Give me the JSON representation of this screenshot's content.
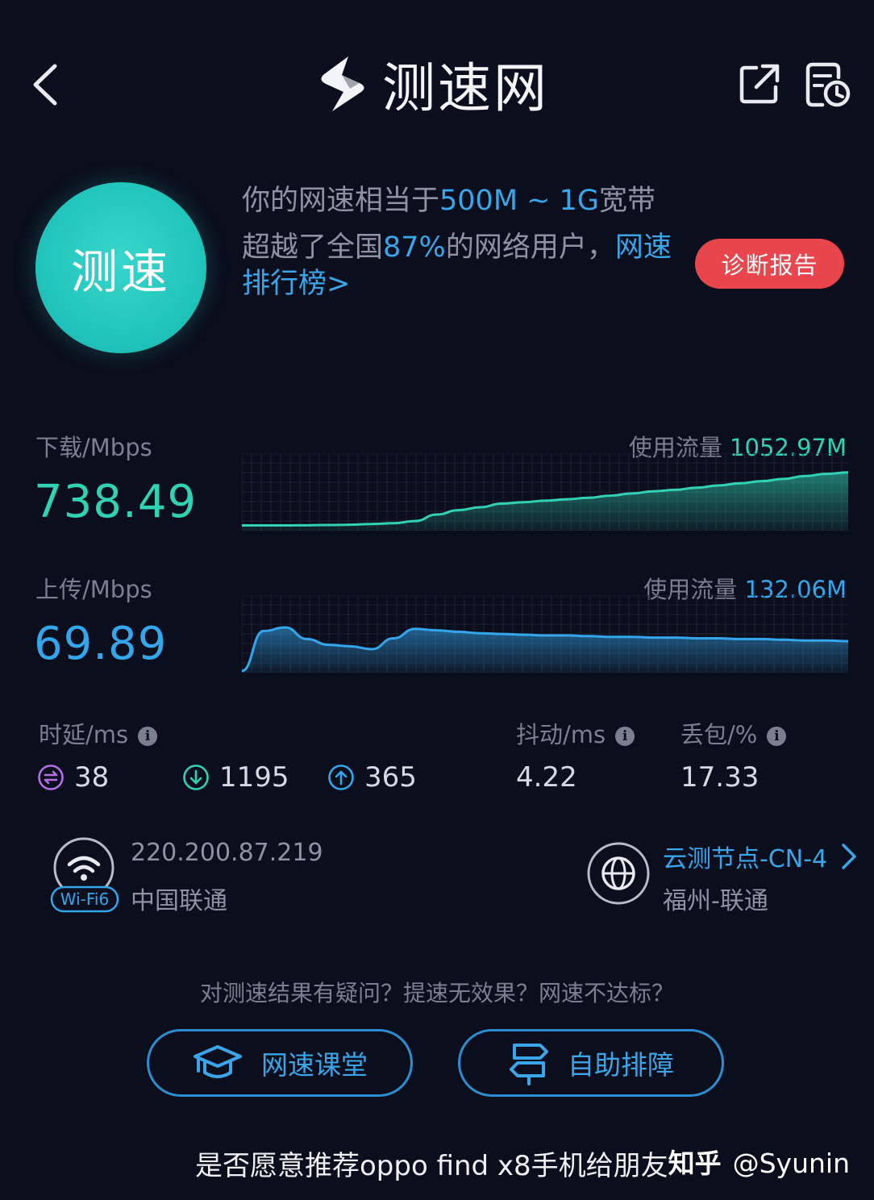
{
  "header": {
    "title": "测速网"
  },
  "test_button": {
    "label": "测速"
  },
  "summary": {
    "line1_prefix": "你的网速相当于",
    "line1_highlight": "500M ~ 1G",
    "line1_suffix": "宽带",
    "line2_prefix": "超越了全国",
    "line2_highlight": "87%",
    "line2_suffix": "的网络用户，",
    "rank_link": "网速排行榜>"
  },
  "diagnose_button": {
    "label": "诊断报告"
  },
  "download": {
    "label": "下载/Mbps",
    "value": "738.49",
    "traffic_label": "使用流量",
    "traffic_value": "1052.97M"
  },
  "upload": {
    "label": "上传/Mbps",
    "value": "69.89",
    "traffic_label": "使用流量",
    "traffic_value": "132.06M"
  },
  "latency": {
    "label": "时延/ms",
    "avg": "38",
    "down": "1195",
    "up": "365"
  },
  "jitter": {
    "label": "抖动/ms",
    "value": "4.22"
  },
  "packet_loss": {
    "label": "丢包/%",
    "value": "17.33"
  },
  "network": {
    "wifi_badge": "Wi-Fi6",
    "ip": "220.200.87.219",
    "isp": "中国联通"
  },
  "server": {
    "node": "云测节点-CN-4",
    "location": "福州-联通"
  },
  "footer": {
    "question": "对测速结果有疑问？提速无效果？网速不达标？",
    "course_button": "网速课堂",
    "troubleshoot_button": "自助排障"
  },
  "caption": "是否愿意推荐oppo find x8手机给朋友",
  "watermark": {
    "brand": "知乎",
    "user": "@Syunin"
  },
  "colors": {
    "background": "#0b0e1c",
    "download_accent": "#31d2b4",
    "upload_accent": "#34a6ec",
    "diagnose_red": "#e8454c",
    "test_teal": "#20c4ba"
  },
  "chart_data": [
    {
      "type": "area",
      "series": [
        {
          "values": [
            5,
            5,
            5,
            5.2,
            5.5,
            6,
            7,
            8,
            11,
            20,
            26,
            30,
            35,
            37,
            39,
            41,
            43,
            46,
            49,
            52,
            54,
            57,
            60,
            63,
            66,
            69,
            73,
            76,
            78
          ]
        }
      ]
    },
    {
      "type": "area",
      "series": [
        {
          "values": [
            0,
            55,
            60,
            44,
            36,
            34,
            30,
            45,
            58,
            56,
            54,
            52,
            51,
            50,
            49,
            49,
            48,
            47,
            47,
            46,
            46,
            45,
            45,
            44,
            44,
            43,
            42,
            42,
            41
          ]
        }
      ]
    }
  ]
}
